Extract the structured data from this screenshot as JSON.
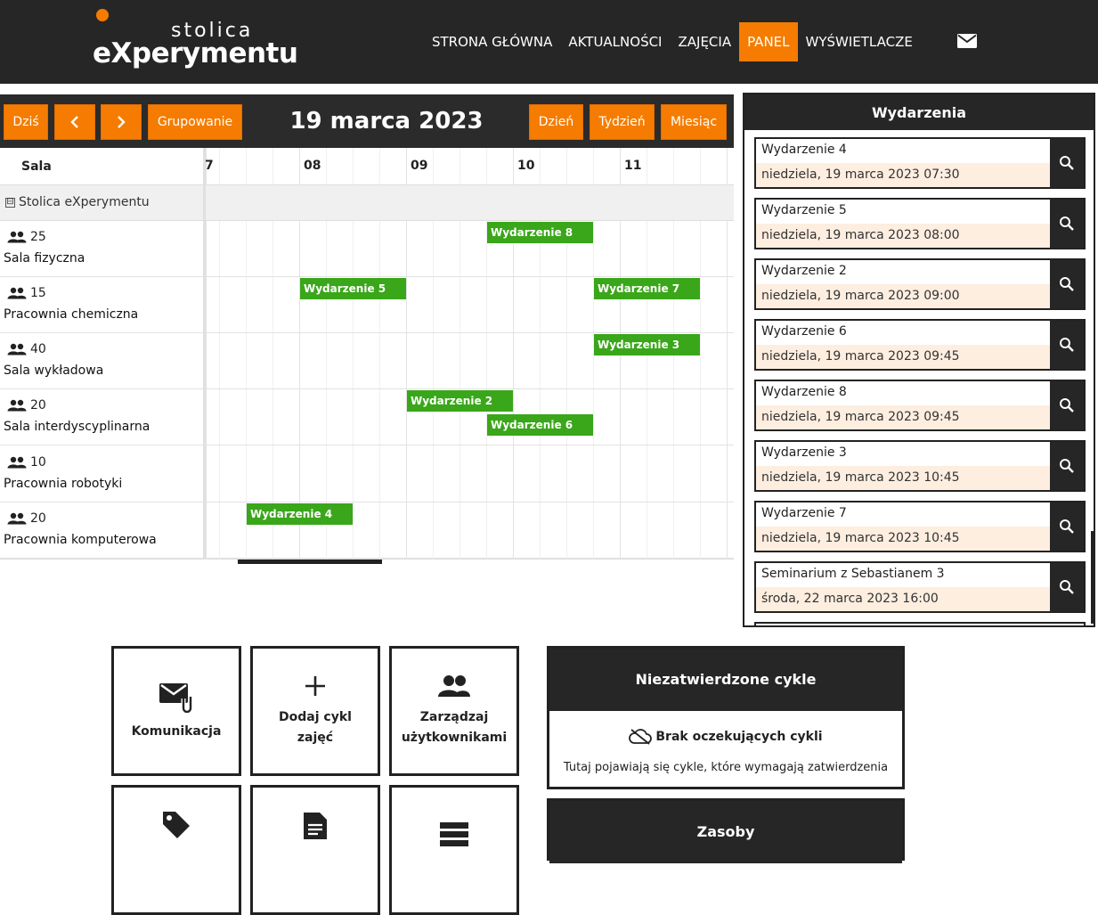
{
  "header": {
    "logo_small": "stolica",
    "logo_big": "eXperymentu",
    "nav": [
      {
        "label": "STRONA GŁÓWNA",
        "active": false
      },
      {
        "label": "AKTUALNOŚCI",
        "active": false
      },
      {
        "label": "ZAJĘCIA",
        "active": false
      },
      {
        "label": "PANEL",
        "active": true
      },
      {
        "label": "WYŚWIETLACZE",
        "active": false
      }
    ],
    "mail_icon": "envelope-icon",
    "accent_color": "#f57c00",
    "bar_color": "#262626"
  },
  "calendar": {
    "today_label": "Dziś",
    "prev_icon": "chevron-left-icon",
    "next_icon": "chevron-right-icon",
    "grouping_label": "Grupowanie",
    "title": "19 marca 2023",
    "view_day": "Dzień",
    "view_week": "Tydzień",
    "view_month": "Miesiąc",
    "resource_header": "Sala",
    "hours": [
      "7",
      "08",
      "09",
      "10",
      "11"
    ],
    "group_label": "Stolica eXperymentu",
    "group_toggle": "⊟",
    "event_color": "#3aa61a",
    "rooms": [
      {
        "capacity": "25",
        "name": "Sala fizyczna"
      },
      {
        "capacity": "15",
        "name": "Pracownia chemiczna"
      },
      {
        "capacity": "40",
        "name": "Sala wykładowa"
      },
      {
        "capacity": "20",
        "name": "Sala interdyscyplinarna"
      },
      {
        "capacity": "10",
        "name": "Pracownia robotyki"
      },
      {
        "capacity": "20",
        "name": "Pracownia komputerowa"
      }
    ],
    "events": [
      {
        "label": "Wydarzenie 8",
        "room": 0,
        "start": "09:45",
        "end": "10:45"
      },
      {
        "label": "Wydarzenie 5",
        "room": 1,
        "start": "08:00",
        "end": "09:00"
      },
      {
        "label": "Wydarzenie 7",
        "room": 1,
        "start": "10:45",
        "end": "11:45"
      },
      {
        "label": "Wydarzenie 3",
        "room": 2,
        "start": "10:45",
        "end": "11:45"
      },
      {
        "label": "Wydarzenie 2",
        "room": 3,
        "start": "09:00",
        "end": "10:00"
      },
      {
        "label": "Wydarzenie 6",
        "room": 3,
        "start": "09:45",
        "end": "10:45"
      },
      {
        "label": "Wydarzenie 4",
        "room": 5,
        "start": "07:30",
        "end": "08:30"
      }
    ]
  },
  "events_panel": {
    "title": "Wydarzenia",
    "items": [
      {
        "title": "Wydarzenie 4",
        "date": "niedziela, 19 marca 2023 07:30"
      },
      {
        "title": "Wydarzenie 5",
        "date": "niedziela, 19 marca 2023 08:00"
      },
      {
        "title": "Wydarzenie 2",
        "date": "niedziela, 19 marca 2023 09:00"
      },
      {
        "title": "Wydarzenie 6",
        "date": "niedziela, 19 marca 2023 09:45"
      },
      {
        "title": "Wydarzenie 8",
        "date": "niedziela, 19 marca 2023 09:45"
      },
      {
        "title": "Wydarzenie 3",
        "date": "niedziela, 19 marca 2023 10:45"
      },
      {
        "title": "Wydarzenie 7",
        "date": "niedziela, 19 marca 2023 10:45"
      },
      {
        "title": "Seminarium z Sebastianem 3",
        "date": "środa, 22 marca 2023 16:00"
      }
    ],
    "search_icon": "search-icon"
  },
  "tiles": {
    "communication": "Komunikacja",
    "add_cycle": "Dodaj cykl zajęć",
    "manage_users": "Zarządzaj użytkownikami"
  },
  "cycles_panel": {
    "title": "Niezatwierdzone cykle",
    "empty_title": "Brak oczekujących cykli",
    "empty_desc": "Tutaj pojawiają się cykle, które wymagają zatwierdzenia",
    "icon": "cloud-off-icon"
  },
  "resources_panel": {
    "title": "Zasoby"
  }
}
